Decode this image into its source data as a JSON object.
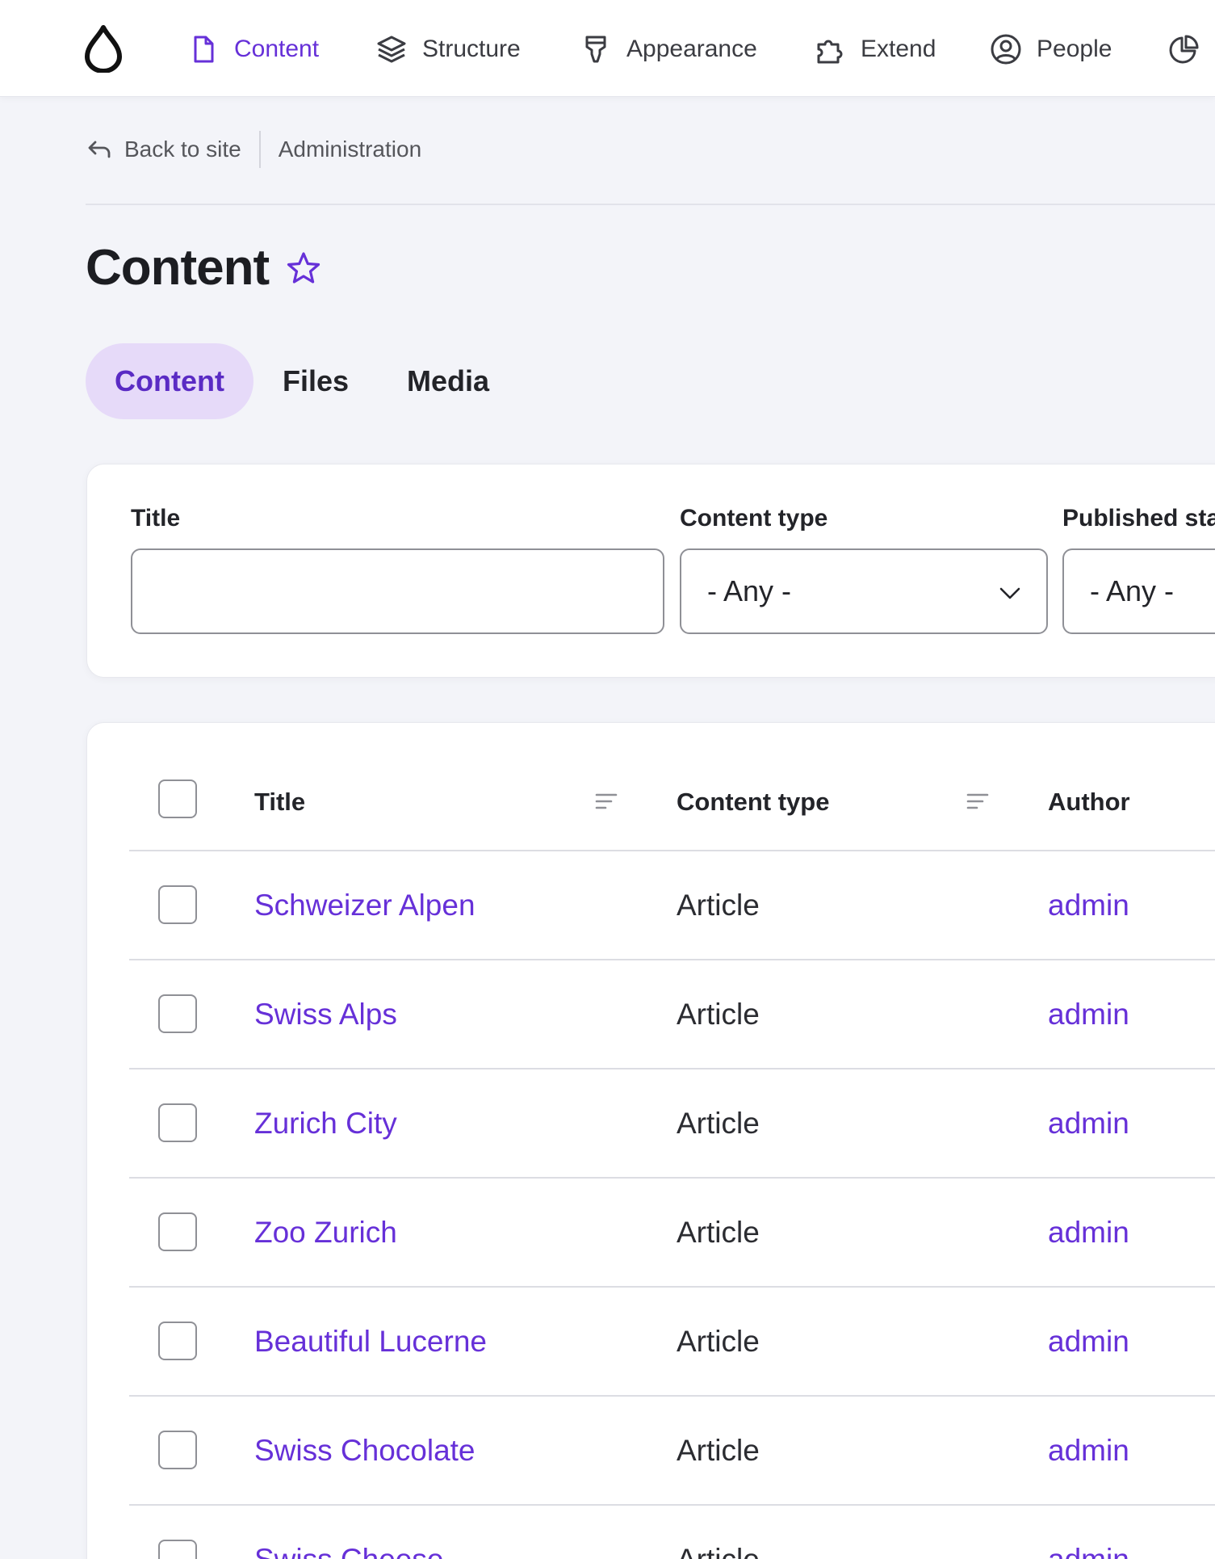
{
  "nav": {
    "items": [
      {
        "label": "Content",
        "icon": "file-icon"
      },
      {
        "label": "Structure",
        "icon": "layers-icon"
      },
      {
        "label": "Appearance",
        "icon": "paintbrush-icon"
      },
      {
        "label": "Extend",
        "icon": "puzzle-icon"
      },
      {
        "label": "People",
        "icon": "user-circle-icon"
      }
    ],
    "active": "Content",
    "accent_color": "#6630d8"
  },
  "breadcrumb": {
    "back_label": "Back to site",
    "current": "Administration"
  },
  "page": {
    "title": "Content"
  },
  "tabs": [
    {
      "label": "Content",
      "active": true
    },
    {
      "label": "Files",
      "active": false
    },
    {
      "label": "Media",
      "active": false
    }
  ],
  "filters": {
    "title_label": "Title",
    "title_value": "",
    "content_type_label": "Content type",
    "content_type_value": "- Any -",
    "published_label": "Published sta",
    "published_value": "- Any -"
  },
  "table": {
    "headers": {
      "title": "Title",
      "content_type": "Content type",
      "author": "Author"
    },
    "rows": [
      {
        "title": "Schweizer Alpen",
        "type": "Article",
        "author": "admin"
      },
      {
        "title": "Swiss Alps",
        "type": "Article",
        "author": "admin"
      },
      {
        "title": "Zurich City",
        "type": "Article",
        "author": "admin"
      },
      {
        "title": "Zoo Zurich",
        "type": "Article",
        "author": "admin"
      },
      {
        "title": "Beautiful Lucerne",
        "type": "Article",
        "author": "admin"
      },
      {
        "title": "Swiss Chocolate",
        "type": "Article",
        "author": "admin"
      },
      {
        "title": "Swiss Cheese",
        "type": "Article",
        "author": "admin"
      }
    ]
  }
}
